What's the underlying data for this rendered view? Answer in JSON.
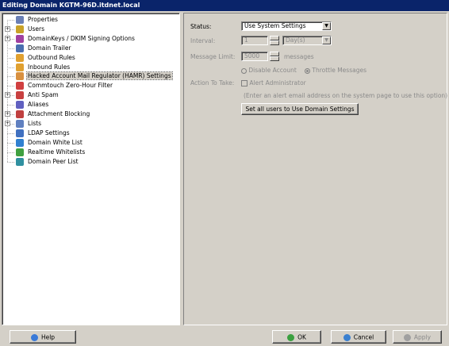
{
  "window": {
    "title": "Editing Domain KGTM-96D.itdnet.local"
  },
  "tree": {
    "items": [
      {
        "label": "Properties",
        "icon": "properties-icon",
        "color": "#6a7fb5",
        "has_children": false
      },
      {
        "label": "Users",
        "icon": "users-icon",
        "color": "#c9a227",
        "has_children": true
      },
      {
        "label": "DomainKeys / DKIM Signing Options",
        "icon": "dkim-icon",
        "color": "#a040a0",
        "has_children": true
      },
      {
        "label": "Domain Trailer",
        "icon": "domain-trailer-icon",
        "color": "#4a6fb0",
        "has_children": false
      },
      {
        "label": "Outbound Rules",
        "icon": "outbound-rules-icon",
        "color": "#e0a030",
        "has_children": false
      },
      {
        "label": "Inbound Rules",
        "icon": "inbound-rules-icon",
        "color": "#e0a030",
        "has_children": false
      },
      {
        "label": "Hacked Account Mail Regulator (HAMR) Settings",
        "icon": "hamr-icon",
        "color": "#d89040",
        "has_children": false,
        "selected": true
      },
      {
        "label": "Commtouch Zero-Hour Filter",
        "icon": "commtouch-icon",
        "color": "#d04040",
        "has_children": false
      },
      {
        "label": "Anti Spam",
        "icon": "anti-spam-icon",
        "color": "#c84040",
        "has_children": true
      },
      {
        "label": "Aliases",
        "icon": "aliases-icon",
        "color": "#6060c0",
        "has_children": false
      },
      {
        "label": "Attachment Blocking",
        "icon": "attachment-blocking-icon",
        "color": "#c04040",
        "has_children": true
      },
      {
        "label": "Lists",
        "icon": "lists-icon",
        "color": "#6080c0",
        "has_children": true
      },
      {
        "label": "LDAP Settings",
        "icon": "ldap-icon",
        "color": "#4070c0",
        "has_children": false
      },
      {
        "label": "Domain White List",
        "icon": "domain-white-list-icon",
        "color": "#3080d0",
        "has_children": false
      },
      {
        "label": "Realtime Whitelists",
        "icon": "realtime-whitelists-icon",
        "color": "#40a040",
        "has_children": false
      },
      {
        "label": "Domain Peer List",
        "icon": "domain-peer-list-icon",
        "color": "#3090a0",
        "has_children": false
      }
    ]
  },
  "hamr": {
    "status_label": "Status:",
    "status_value": "Use System Settings",
    "interval_label": "Interval:",
    "interval_value": "1",
    "interval_unit": "Day(s)",
    "message_limit_label": "Message Limit:",
    "message_limit_value": "5000",
    "message_limit_unit": "messages",
    "disable_account_label": "Disable Account",
    "throttle_messages_label": "Throttle Messages",
    "action_label": "Action To Take:",
    "alert_admin_label": "Alert Administrator",
    "alert_hint": "(Enter an alert email address on the system page to use this option)",
    "set_all_button": "Set all users to Use Domain Settings"
  },
  "footer": {
    "help": "Help",
    "ok": "OK",
    "cancel": "Cancel",
    "apply": "Apply"
  },
  "colors": {
    "titlebar": "#0a246a",
    "help_icon": "#3a7ad8",
    "ok_icon": "#3aa040",
    "cancel_icon": "#3a80d0",
    "apply_icon": "#a0a0a0"
  }
}
